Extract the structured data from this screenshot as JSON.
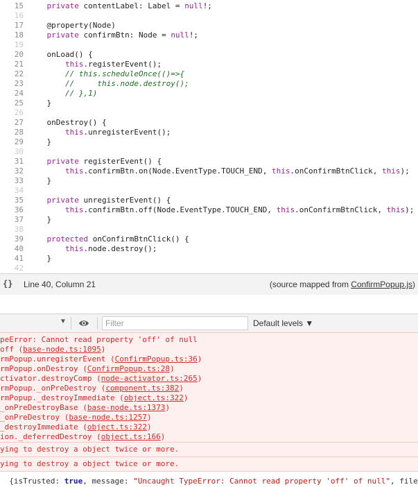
{
  "editor": {
    "lines": [
      {
        "num": "15",
        "html": "    <span class=\"tok-kw\">private</span> contentLabel: Label = <span class=\"tok-kw\">null</span>!;"
      },
      {
        "num": "16",
        "html": ""
      },
      {
        "num": "17",
        "html": "    @property(Node)"
      },
      {
        "num": "18",
        "html": "    <span class=\"tok-kw\">private</span> confirmBtn: Node = <span class=\"tok-kw\">null</span>!;"
      },
      {
        "num": "19",
        "html": ""
      },
      {
        "num": "20",
        "html": "    onLoad() {"
      },
      {
        "num": "21",
        "html": "        <span class=\"tok-kw\">this</span>.registerEvent();"
      },
      {
        "num": "22",
        "html": "        <span class=\"tok-cm\">// this.scheduleOnce(()=>{</span>"
      },
      {
        "num": "23",
        "html": "        <span class=\"tok-cm\">//     this.node.destroy();</span>"
      },
      {
        "num": "24",
        "html": "        <span class=\"tok-cm\">// },1)</span>"
      },
      {
        "num": "25",
        "html": "    }"
      },
      {
        "num": "26",
        "html": ""
      },
      {
        "num": "27",
        "html": "    onDestroy() {"
      },
      {
        "num": "28",
        "html": "        <span class=\"tok-kw\">this</span>.unregisterEvent();"
      },
      {
        "num": "29",
        "html": "    }"
      },
      {
        "num": "30",
        "html": ""
      },
      {
        "num": "31",
        "html": "    <span class=\"tok-kw\">private</span> registerEvent() {"
      },
      {
        "num": "32",
        "html": "        <span class=\"tok-kw\">this</span>.confirmBtn.on(Node.EventType.TOUCH_END, <span class=\"tok-kw\">this</span>.onConfirmBtnClick, <span class=\"tok-kw\">this</span>);"
      },
      {
        "num": "33",
        "html": "    }"
      },
      {
        "num": "34",
        "html": ""
      },
      {
        "num": "35",
        "html": "    <span class=\"tok-kw\">private</span> unregisterEvent() {"
      },
      {
        "num": "36",
        "html": "        <span class=\"tok-kw\">this</span>.confirmBtn.off(Node.EventType.TOUCH_END, <span class=\"tok-kw\">this</span>.onConfirmBtnClick, <span class=\"tok-kw\">this</span>);"
      },
      {
        "num": "37",
        "html": "    }"
      },
      {
        "num": "38",
        "html": ""
      },
      {
        "num": "39",
        "html": "    <span class=\"tok-kw\">protected</span> onConfirmBtnClick() {"
      },
      {
        "num": "40",
        "html": "        <span class=\"tok-kw\">this</span>.node.destroy();"
      },
      {
        "num": "41",
        "html": "    }"
      },
      {
        "num": "42",
        "html": ""
      }
    ]
  },
  "status_bar": {
    "braces_icon": "{}",
    "cursor_position": "Line 40, Column 21",
    "source_mapped_prefix": "(source mapped from ",
    "source_mapped_file": "ConfirmPopup.js",
    "source_mapped_suffix": ")"
  },
  "console_toolbar": {
    "context_caret": "▼",
    "filter_placeholder": "Filter",
    "levels_label": "Default levels ▼"
  },
  "console": {
    "error_lines": [
      {
        "text": "peError: Cannot read property 'off' of null",
        "link": "",
        "after": ""
      },
      {
        "text": "off (",
        "link": "base-node.ts:1095",
        "after": ")"
      },
      {
        "text": "rmPopup.unregisterEvent (",
        "link": "ConfirmPopup.ts:36",
        "after": ")"
      },
      {
        "text": "rmPopup.onDestroy (",
        "link": "ConfirmPopup.ts:28",
        "after": ")"
      },
      {
        "text": "ctivator.destroyComp (",
        "link": "node-activator.ts:265",
        "after": ")"
      },
      {
        "text": "rmPopup._onPreDestroy (",
        "link": "component.ts:382",
        "after": ")"
      },
      {
        "text": "rmPopup._destroyImmediate (",
        "link": "object.ts:322",
        "after": ")"
      },
      {
        "text": "_onPreDestroyBase (",
        "link": "base-node.ts:1373",
        "after": ")"
      },
      {
        "text": "_onPreDestroy (",
        "link": "base-node.ts:1257",
        "after": ")"
      },
      {
        "text": "_destroyImmediate (",
        "link": "object.ts:322",
        "after": ")"
      },
      {
        "text": "ion._deferredDestroy (",
        "link": "object.ts:166",
        "after": ")"
      }
    ],
    "warnings": [
      "ying to destroy a object twice or more.",
      "ying to destroy a object twice or more."
    ],
    "result_prefix": "  {isTrusted: ",
    "result_true": "true",
    "result_mid": ", message: ",
    "result_message": "\"Uncaught TypeError: Cannot read property 'off' of null\"",
    "result_suffix": ", filena"
  }
}
